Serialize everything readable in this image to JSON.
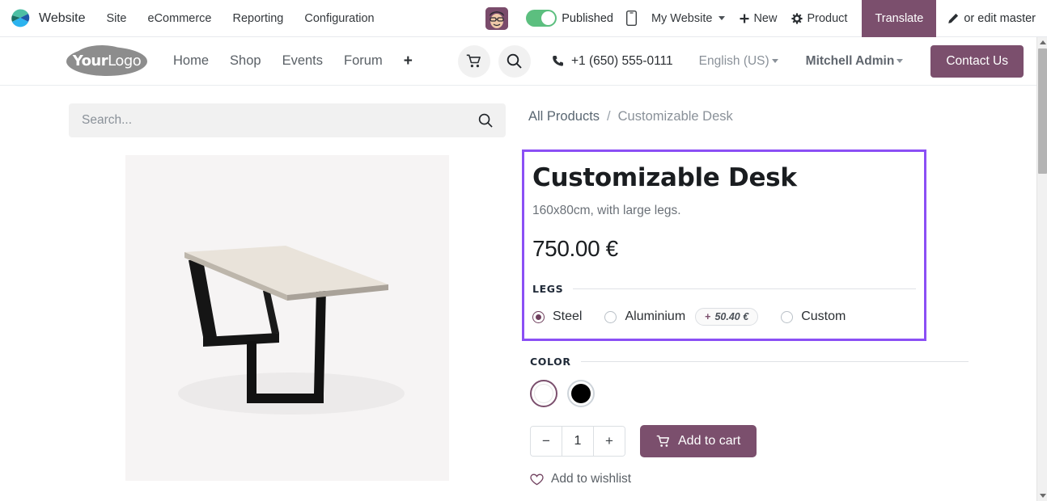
{
  "sysbar": {
    "app_name": "Website",
    "menu": [
      "Site",
      "eCommerce",
      "Reporting",
      "Configuration"
    ],
    "published_label": "Published",
    "website_selector": "My Website",
    "new_label": "New",
    "product_label": "Product",
    "translate_label": "Translate",
    "edit_master_label": "or edit master",
    "accent_color": "#7b4f6d",
    "published_color": "#5cbf7f"
  },
  "site_header": {
    "logo_bold": "Your",
    "logo_light": "Logo",
    "nav": [
      "Home",
      "Shop",
      "Events",
      "Forum"
    ],
    "nav_add": "+",
    "phone": "+1 (650) 555-0111",
    "language": "English (US)",
    "user": "Mitchell Admin",
    "contact_label": "Contact Us"
  },
  "search": {
    "value": "",
    "placeholder": "Search..."
  },
  "breadcrumb": {
    "parent": "All Products",
    "separator": "/",
    "current": "Customizable Desk"
  },
  "product": {
    "title": "Customizable Desk",
    "description": "160x80cm, with large legs.",
    "price": "750.00 €",
    "edit_border_color": "#8b4ff5",
    "attributes": [
      {
        "name": "LEGS",
        "options": [
          {
            "label": "Steel",
            "selected": true,
            "extra_price": ""
          },
          {
            "label": "Aluminium",
            "selected": false,
            "extra_price": "50.40 €",
            "extra_sign": "+"
          },
          {
            "label": "Custom",
            "selected": false,
            "extra_price": ""
          }
        ]
      }
    ],
    "color_attribute": {
      "name": "COLOR",
      "swatches": [
        {
          "hex": "#ffffff",
          "selected": true
        },
        {
          "hex": "#000000",
          "selected": false
        }
      ]
    },
    "quantity": "1",
    "decrease_label": "−",
    "increase_label": "+",
    "add_to_cart_label": "Add to cart",
    "wishlist_label": "Add to wishlist"
  }
}
